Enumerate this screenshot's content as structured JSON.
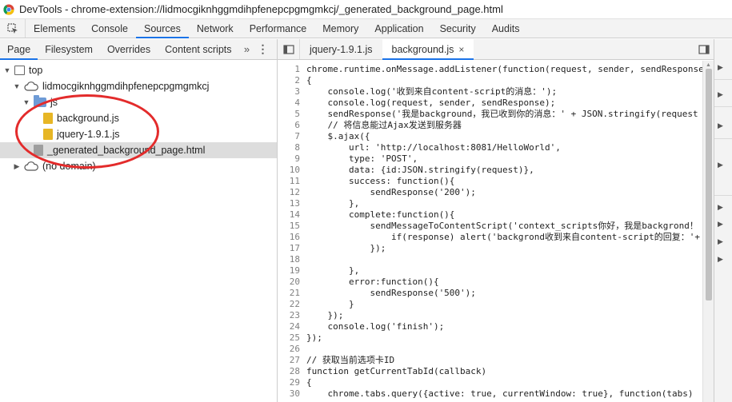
{
  "window": {
    "title": "DevTools - chrome-extension://lidmocgiknhggmdihpfenepcpgmgmkcj/_generated_background_page.html"
  },
  "main_tabs": [
    "Elements",
    "Console",
    "Sources",
    "Network",
    "Performance",
    "Memory",
    "Application",
    "Security",
    "Audits"
  ],
  "active_main_tab": "Sources",
  "navigator": {
    "tabs": [
      "Page",
      "Filesystem",
      "Overrides",
      "Content scripts"
    ],
    "more_label": "»",
    "menu_label": "⋮",
    "tree": [
      {
        "label": "top"
      },
      {
        "label": "lidmocgiknhggmdihpfenepcpgmgmkcj"
      },
      {
        "label": "js"
      },
      {
        "label": "background.js"
      },
      {
        "label": "jquery-1.9.1.js"
      },
      {
        "label": "_generated_background_page.html"
      },
      {
        "label": "(no domain)"
      }
    ]
  },
  "editor": {
    "tabs": [
      {
        "label": "jquery-1.9.1.js"
      },
      {
        "label": "background.js",
        "close": "×"
      }
    ],
    "line_numbers": [
      "1",
      "2",
      "3",
      "4",
      "5",
      "6",
      "7",
      "8",
      "9",
      "10",
      "11",
      "12",
      "13",
      "14",
      "15",
      "16",
      "17",
      "18",
      "19",
      "20",
      "21",
      "22",
      "23",
      "24",
      "25",
      "26",
      "27",
      "28",
      "29",
      "30"
    ],
    "code_lines": [
      "chrome.runtime.onMessage.addListener(function(request, sender, sendResponse)",
      "{",
      "    console.log('收到来自content-script的消息：');",
      "    console.log(request, sender, sendResponse);",
      "    sendResponse('我是background，我已收到你的消息：' + JSON.stringify(request",
      "    // 将信息能过Ajax发送到服务器",
      "    $.ajax({",
      "        url: 'http://localhost:8081/HelloWorld',",
      "        type: 'POST',",
      "        data: {id:JSON.stringify(request)},",
      "        success: function(){",
      "            sendResponse('200');",
      "        },",
      "        complete:function(){",
      "            sendMessageToContentScript('context_scripts你好，我是backgrond！",
      "                if(response) alert('backgrond收到来自content-script的回复：'+",
      "            });",
      "",
      "        },",
      "        error:function(){",
      "            sendResponse('500');",
      "        }",
      "    });",
      "    console.log('finish');",
      "});",
      "",
      "// 获取当前选项卡ID",
      "function getCurrentTabId(callback)",
      "{",
      "    chrome.tabs.query({active: true, currentWindow: true}, function(tabs)"
    ]
  },
  "colors": {
    "accent": "#1a73e8",
    "annotation": "#e32b2b",
    "selected_row": "#dddddd"
  },
  "icons": [
    "chrome-logo-icon",
    "inspect-element-icon",
    "toggle-navigator-icon",
    "toggle-debugger-icon",
    "frame-icon",
    "cloud-icon",
    "folder-icon",
    "file-icon"
  ]
}
